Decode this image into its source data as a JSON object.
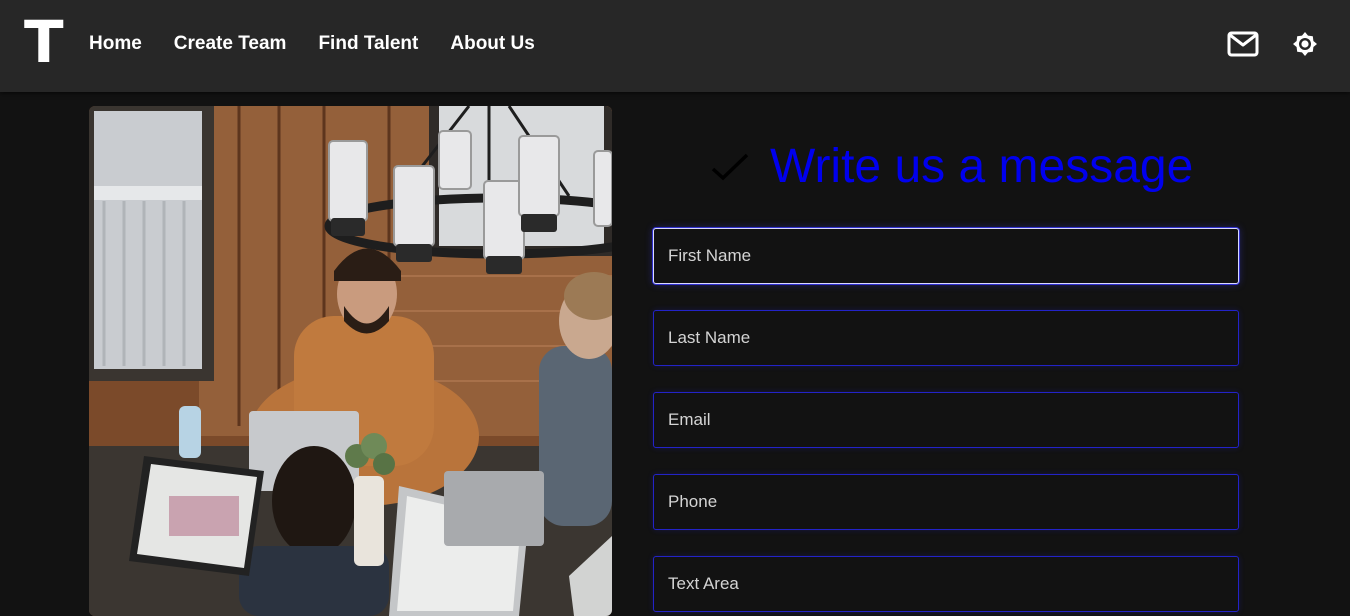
{
  "navbar": {
    "logo_text": "T",
    "links": [
      {
        "label": "Home"
      },
      {
        "label": "Create Team"
      },
      {
        "label": "Find Talent"
      },
      {
        "label": "About Us"
      }
    ],
    "icons": [
      "mail-icon",
      "brightness-icon"
    ]
  },
  "hero_image": {
    "icon": "team-photo"
  },
  "form": {
    "title": "Write us a message",
    "title_icon": "check-icon",
    "title_color": "#0000ee",
    "fields": [
      {
        "placeholder": "First Name",
        "value": "",
        "focused": true
      },
      {
        "placeholder": "Last Name",
        "value": ""
      },
      {
        "placeholder": "Email",
        "value": ""
      },
      {
        "placeholder": "Phone",
        "value": ""
      },
      {
        "placeholder": "Text Area",
        "value": ""
      }
    ]
  },
  "colors": {
    "background": "#121212",
    "navbar": "#272727",
    "field_border": "#2323c8",
    "accent": "#0000ee"
  }
}
